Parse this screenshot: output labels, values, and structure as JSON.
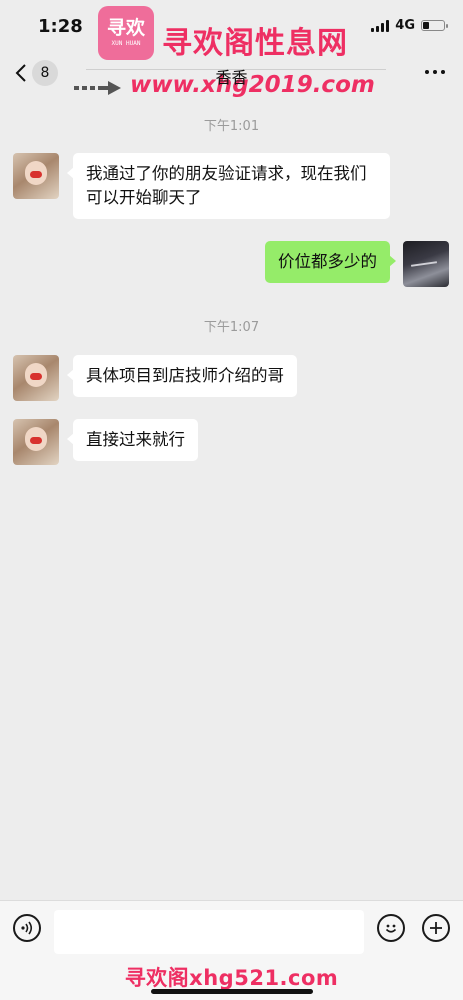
{
  "status_bar": {
    "time": "1:28",
    "network": "4G"
  },
  "watermark": {
    "logo_text": "寻欢",
    "logo_subtext": "XUN HUAN",
    "site_name": "寻欢阁性息网",
    "url": "www.xhg2019.com",
    "bottom_text": "寻欢阁xhg521.com",
    "color": "#ee2f63"
  },
  "nav": {
    "back_icon": "chevron-left-icon",
    "unread_count": "8",
    "title": "香香",
    "more_icon": "more-dots-icon"
  },
  "chat": {
    "messages": [
      {
        "type": "timestamp",
        "text": "下午1:01"
      },
      {
        "type": "received",
        "text": "我通过了你的朋友验证请求，现在我们可以开始聊天了"
      },
      {
        "type": "sent",
        "text": "价位都多少的"
      },
      {
        "type": "timestamp",
        "text": "下午1:07"
      },
      {
        "type": "received",
        "text": "具体项目到店技师介绍的哥"
      },
      {
        "type": "received",
        "text": "直接过来就行"
      }
    ],
    "sent_bubble_color": "#95ec69",
    "received_bubble_color": "#ffffff",
    "background_color": "#ededed"
  },
  "input_bar": {
    "voice_icon": "voice-icon",
    "text_value": "",
    "emoji_icon": "emoji-icon",
    "plus_icon": "plus-icon"
  }
}
